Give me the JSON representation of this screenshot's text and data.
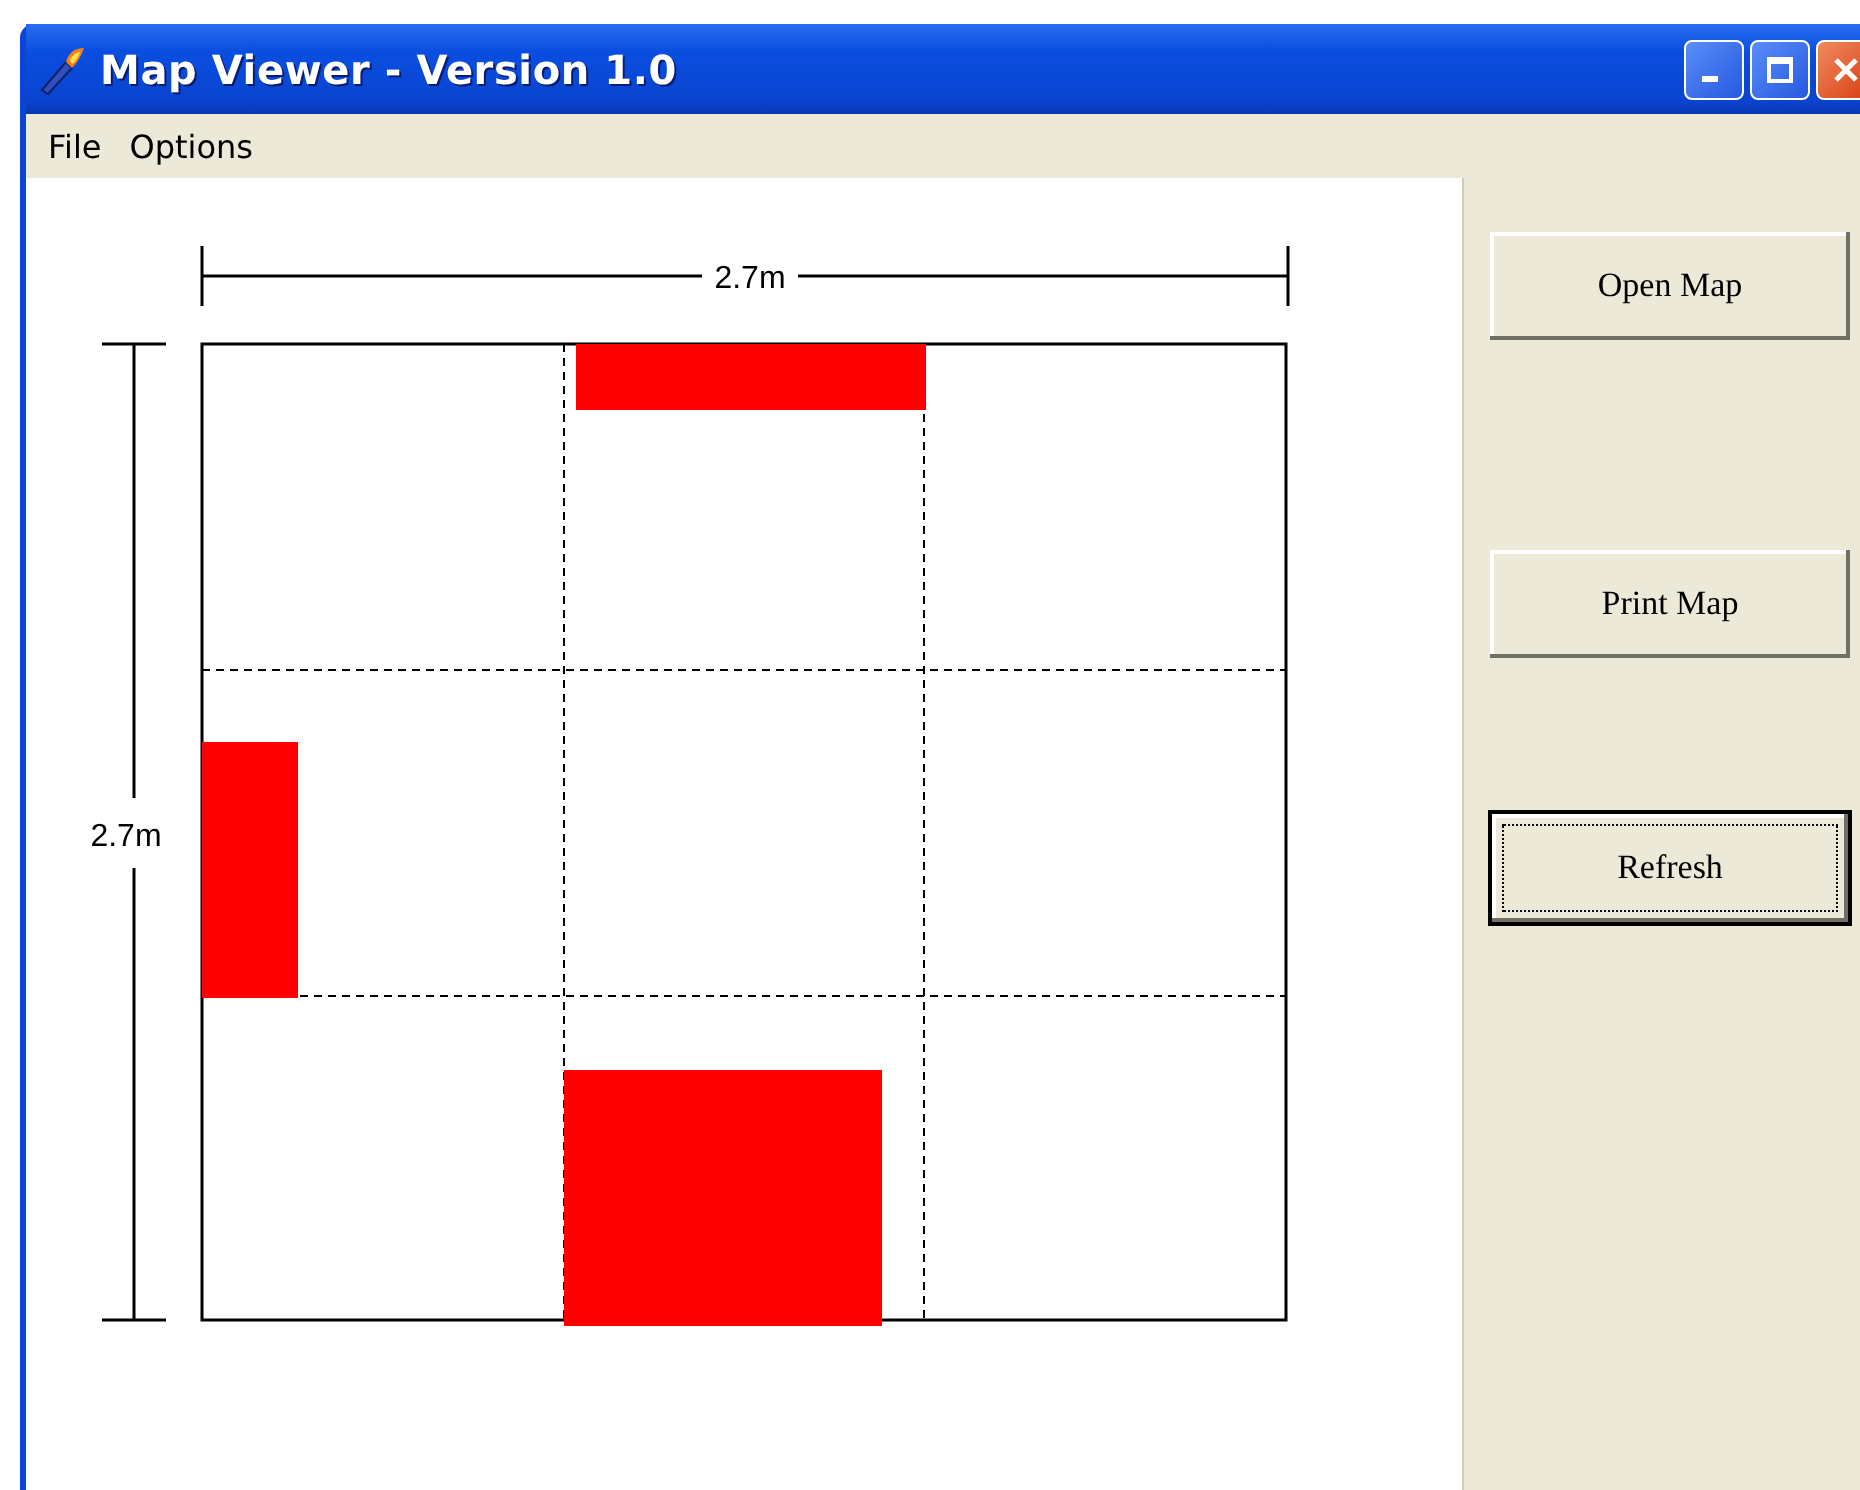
{
  "window": {
    "title": "Map Viewer - Version 1.0"
  },
  "menu": [
    "File",
    "Options"
  ],
  "map": {
    "width_label": "2.7m",
    "height_label": "2.7m"
  },
  "buttons": [
    {
      "label": "Open Map",
      "focused": false
    },
    {
      "label": "Print Map",
      "focused": false
    },
    {
      "label": "Refresh",
      "focused": true
    }
  ]
}
